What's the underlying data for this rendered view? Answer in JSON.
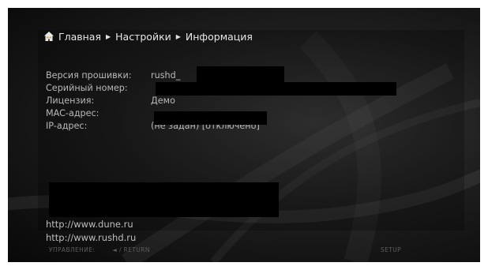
{
  "breadcrumb": {
    "icon": "home-icon",
    "items": [
      "Главная",
      "Настройки",
      "Информация"
    ]
  },
  "info": {
    "firmware": {
      "label": "Версия прошивки:",
      "value": "rushd_"
    },
    "serial": {
      "label": "Серийный номер:",
      "value": ""
    },
    "license": {
      "label": "Лицензия:",
      "value": "Демо"
    },
    "mac": {
      "label": "MAC-адрес:",
      "value": ""
    },
    "ip": {
      "label": "IP-адрес:",
      "value": "(не задан) [отключено]"
    }
  },
  "links": [
    "http://www.dune.ru",
    "http://www.rushd.ru"
  ],
  "footer": {
    "control_label": "УПРАВЛЕНИЕ:",
    "control_hint": "◄ / RETURN",
    "setup": "SETUP"
  },
  "colors": {
    "background": "#1e1e1e",
    "text": "#e6e6e6",
    "label_text": "#b9b9b9",
    "footer_text": "#5c5c5c",
    "redaction": "#000000"
  }
}
